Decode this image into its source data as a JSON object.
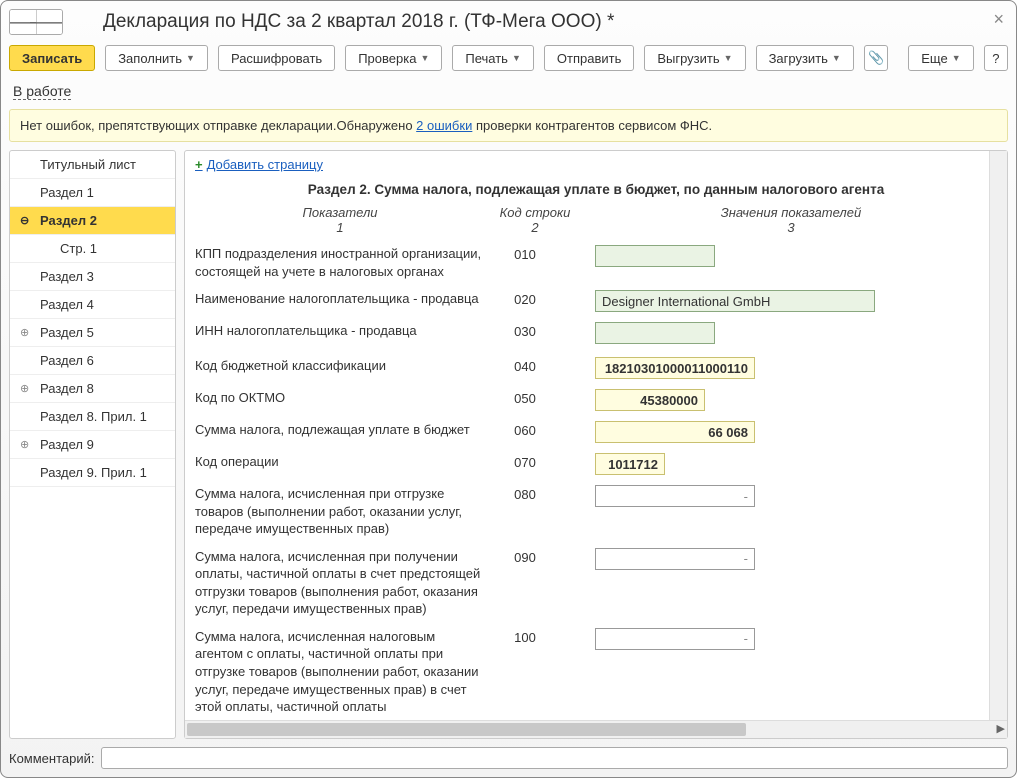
{
  "window": {
    "title": "Декларация по НДС за 2 квартал 2018 г. (ТФ-Мега ООО) *"
  },
  "toolbar": {
    "write": "Записать",
    "fill": "Заполнить",
    "decrypt": "Расшифровать",
    "check": "Проверка",
    "print": "Печать",
    "send": "Отправить",
    "upload": "Выгрузить",
    "download": "Загрузить",
    "more": "Еще",
    "help": "?"
  },
  "status_link": "В работе",
  "infobar": {
    "part1": "Нет ошибок, препятствующих отправке декларации.Обнаружено ",
    "link": "2 ошибки",
    "part2": " проверки контрагентов сервисом ФНС."
  },
  "sidebar": [
    {
      "label": "Титульный лист",
      "level": 1
    },
    {
      "label": "Раздел 1",
      "level": 1
    },
    {
      "label": "Раздел 2",
      "level": 1,
      "active": true,
      "expandable": true,
      "expanded": true
    },
    {
      "label": "Стр. 1",
      "level": 2
    },
    {
      "label": "Раздел 3",
      "level": 1
    },
    {
      "label": "Раздел 4",
      "level": 1
    },
    {
      "label": "Раздел 5",
      "level": 1,
      "expandable": true
    },
    {
      "label": "Раздел 6",
      "level": 1
    },
    {
      "label": "Раздел 8",
      "level": 1,
      "expandable": true
    },
    {
      "label": "Раздел 8. Прил. 1",
      "level": 1
    },
    {
      "label": "Раздел 9",
      "level": 1,
      "expandable": true
    },
    {
      "label": "Раздел 9. Прил. 1",
      "level": 1
    }
  ],
  "content": {
    "add_page": "Добавить страницу",
    "section_title": "Раздел 2. Сумма налога, подлежащая уплате в бюджет, по данным налогового агента",
    "columns": {
      "c1": "Показатели",
      "c1sub": "1",
      "c2": "Код строки",
      "c2sub": "2",
      "c3": "Значения показателей",
      "c3sub": "3"
    },
    "rows": [
      {
        "label": "КПП подразделения иностранной организации, состоящей на учете в налоговых органах",
        "code": "010",
        "value": "",
        "type": "green",
        "w": "w120"
      },
      {
        "label": "Наименование налогоплательщика - продавца",
        "code": "020",
        "value": "Designer International GmbH",
        "type": "green",
        "w": "w280"
      },
      {
        "label": "ИНН налогоплательщика - продавца",
        "code": "030",
        "value": "",
        "type": "green",
        "w": "w120"
      },
      {
        "label": "Код бюджетной классификации",
        "code": "040",
        "value": "18210301000011000110",
        "type": "yellow",
        "w": "w160"
      },
      {
        "label": "Код по ОКТМО",
        "code": "050",
        "value": "45380000",
        "type": "yellow",
        "w": "w110"
      },
      {
        "label": "Сумма налога, подлежащая уплате в бюджет",
        "code": "060",
        "value": "66 068",
        "type": "yellow",
        "w": "w160"
      },
      {
        "label": "Код операции",
        "code": "070",
        "value": "1011712",
        "type": "yellow",
        "w": "w70"
      },
      {
        "label": "Сумма налога, исчисленная при отгрузке товаров (выполнении работ, оказании услуг, передаче имущественных прав)",
        "code": "080",
        "value": "",
        "type": "white",
        "w": "w160",
        "dash": true
      },
      {
        "label": "Сумма налога, исчисленная при получении оплаты, частичной оплаты в счет предстоящей отгрузки товаров (выполнения работ, оказания услуг, передачи имущественных прав)",
        "code": "090",
        "value": "",
        "type": "white",
        "w": "w160",
        "dash": true
      },
      {
        "label": "Сумма налога, исчисленная налоговым агентом с оплаты, частичной оплаты при отгрузке товаров (выполнении работ, оказании услуг, передаче имущественных прав) в счет этой оплаты, частичной оплаты",
        "code": "100",
        "value": "",
        "type": "white",
        "w": "w160",
        "dash": true
      }
    ]
  },
  "comment": {
    "label": "Комментарий:",
    "value": ""
  }
}
